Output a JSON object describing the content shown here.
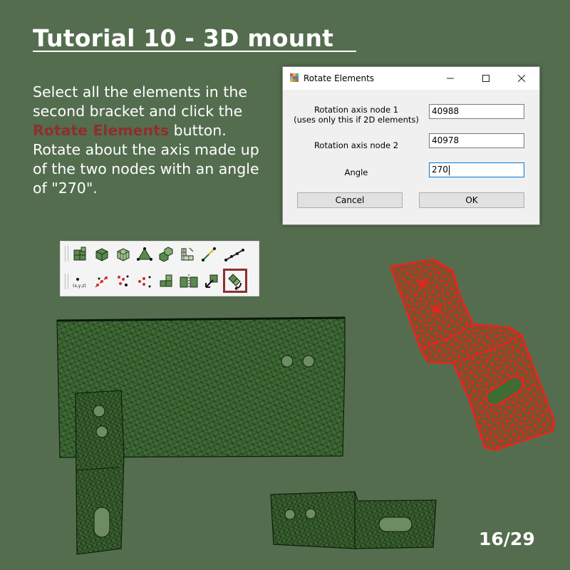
{
  "slide": {
    "title": "Tutorial 10 - 3D mount",
    "instructions_before": "Select all the elements in the second bracket and click the ",
    "instructions_highlight": "Rotate Elements",
    "instructions_after": " button. Rotate about the axis made up of the two nodes with an angle of \"270\".",
    "page_counter": "16/29",
    "colors": {
      "background": "#546d4f",
      "highlight": "#8e2f2f",
      "mesh_fill": "#3f6b35",
      "mesh_selected": "#ff1a1a"
    }
  },
  "dialog": {
    "title": "Rotate Elements",
    "node1_label_line1": "Rotation axis node 1",
    "node1_label_line2": "(uses only this if 2D elements)",
    "node1_value": "40988",
    "node2_label": "Rotation axis node 2",
    "node2_value": "40978",
    "angle_label": "Angle",
    "angle_value": "270",
    "cancel_label": "Cancel",
    "ok_label": "OK"
  },
  "toolbar": {
    "row1_icons": [
      "mesh-grid-icon",
      "cube-icon",
      "cube-wire-icon",
      "triangle-icon",
      "multi-cube-icon",
      "bracket-mesh-icon",
      "line-connect-icon",
      "chain-nodes-icon"
    ],
    "row2_icons": [
      "node-coords-icon",
      "scatter-link-icon",
      "red-nodes-icon",
      "node-cluster-icon",
      "translate-elements-icon",
      "mirror-elements-icon",
      "move-elements-icon",
      "rotate-elements-icon"
    ],
    "node_coords_text": "(x,y,z)"
  }
}
